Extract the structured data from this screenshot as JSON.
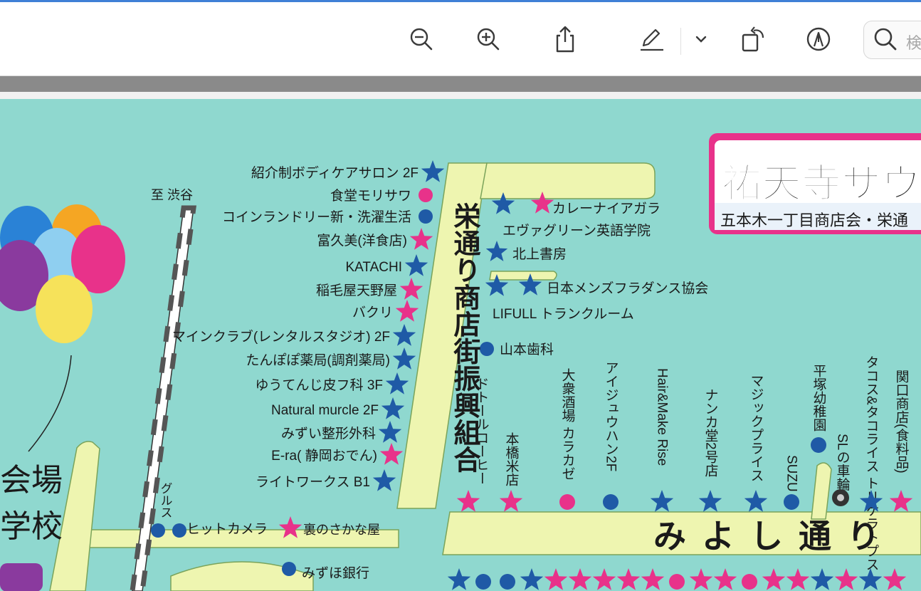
{
  "toolbar": {
    "icons": [
      "zoom-out-icon",
      "zoom-in-icon",
      "share-icon",
      "markup-pen-icon",
      "chevron-down-icon",
      "rotate-icon",
      "annotate-icon"
    ],
    "search_placeholder": "検"
  },
  "map": {
    "main_street": "栄通り商店街振興組合",
    "miyoshi_street": "みよし通り",
    "banner_title": "祐天寺サウス",
    "banner_sub": "五本木一丁目商店会・栄通",
    "to_shibuya": "至 渋谷",
    "venue_partial": "会場",
    "school_partial": "学校",
    "gurusu": "グルス",
    "left_shops": [
      "紹介制ボディケアサロン 2F",
      "食堂モリサワ",
      "コインランドリー新・洗濯生活",
      "富久美(洋食店)",
      "KATACHI",
      "稲毛屋天野屋",
      "バクリ",
      "マインクラブ(レンタルスタジオ) 2F",
      "たんぽぽ薬局(調剤薬局)",
      "ゆうてんじ皮フ科 3F",
      "Natural murcle 2F",
      "みずい整形外科",
      "E-ra( 静岡おでん)",
      "ライトワークス B1"
    ],
    "right_shops": [
      "カレーナイアガラ",
      "エヴァグリーン英語学院",
      "北上書房",
      "日本メンズフラダンス協会",
      "LIFULL トランクルーム",
      "山本歯科"
    ],
    "vertical_shops": [
      "ドトールコーヒー",
      "本橋米店",
      "大衆酒場 カラカゼ",
      "アイジュウハン2F",
      "Hair&Make Rise",
      "ナンカ堂2号店",
      "マジックプライス",
      "SUZU",
      "平塚幼稚園",
      "SLの車輪",
      "タコス&タコライス トリケラトプス",
      "関口商店(食料品)"
    ],
    "bottom_shops": [
      "ヒットカメラ",
      "裏のさかな屋",
      "みずほ銀行"
    ],
    "colors": {
      "teal": "#8fd8cf",
      "road": "#eef5b0",
      "pink": "#e8328a",
      "blue": "#1f5aa6"
    }
  }
}
